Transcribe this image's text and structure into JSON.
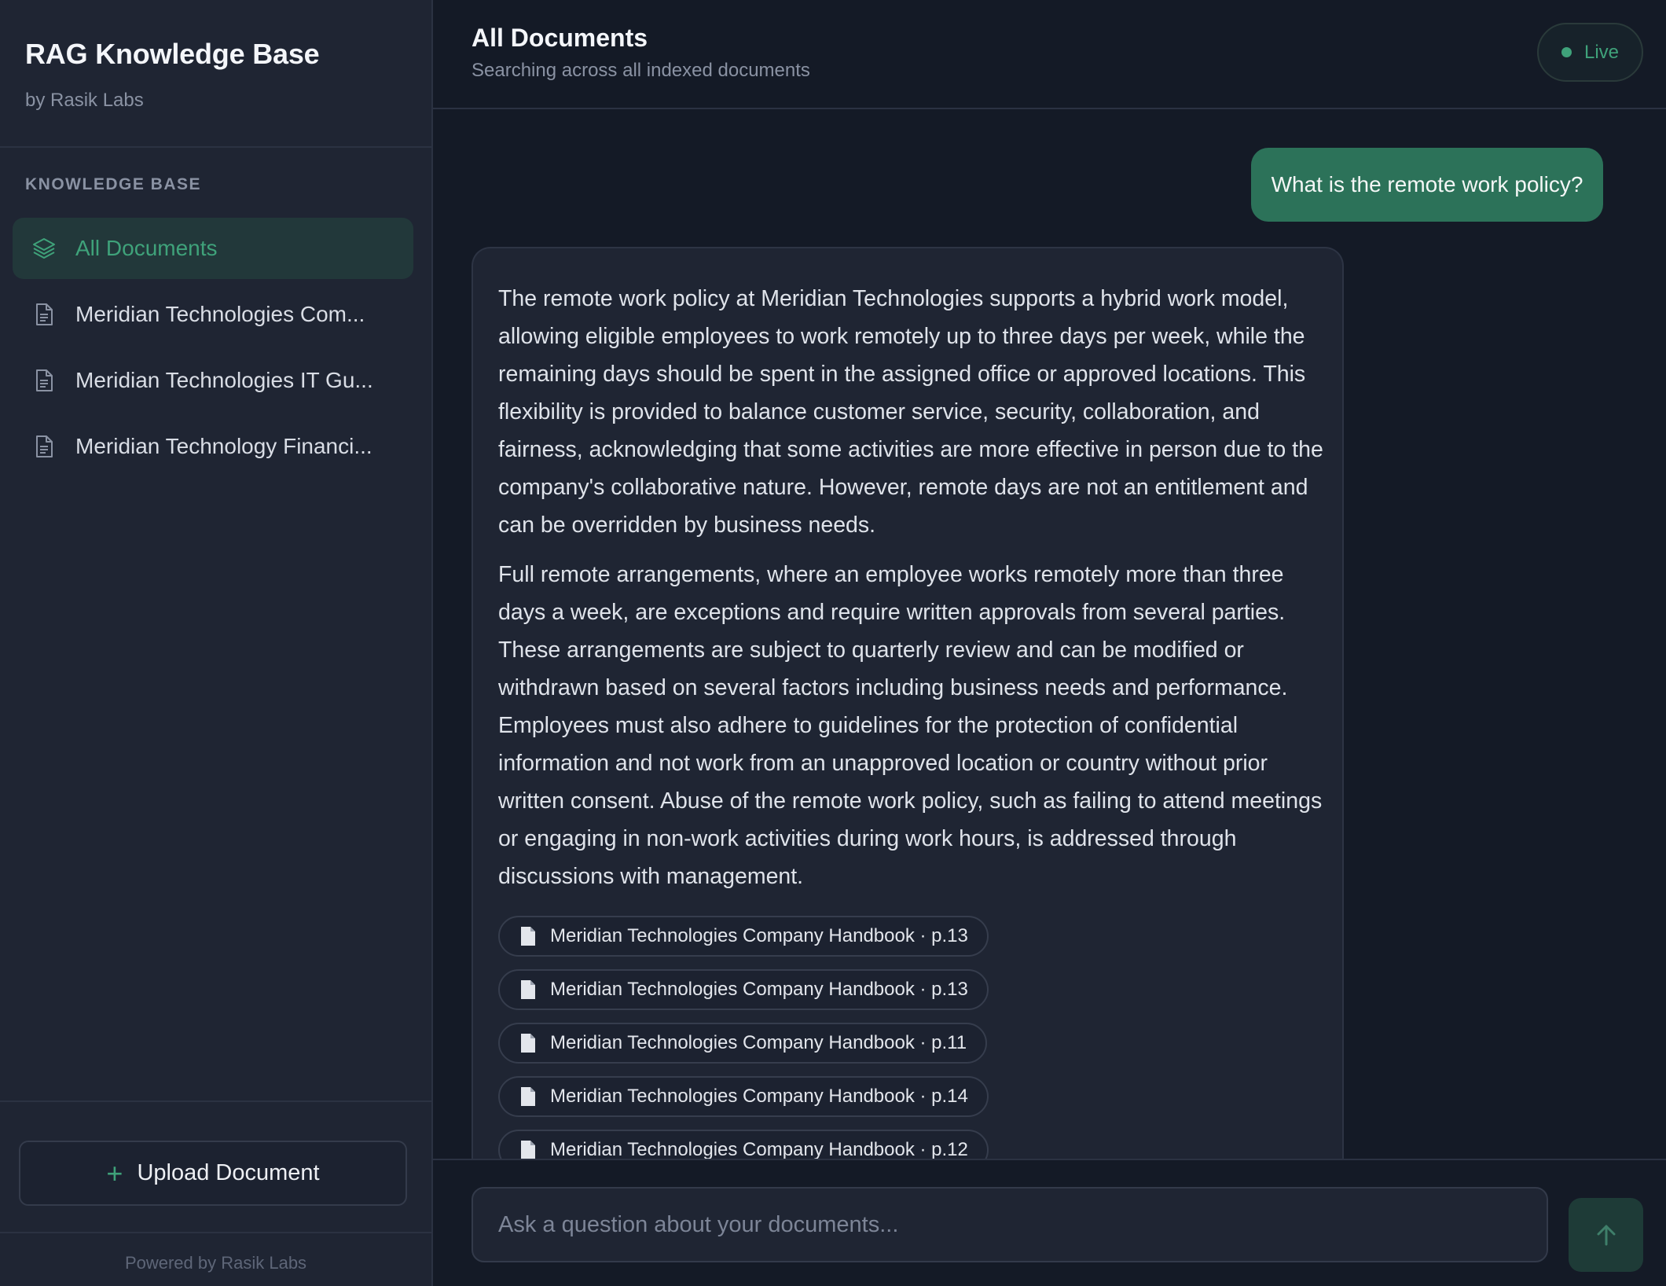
{
  "sidebar": {
    "brand_title": "RAG Knowledge Base",
    "brand_subtitle": "by Rasik Labs",
    "section_label": "KNOWLEDGE BASE",
    "items": [
      {
        "label": "All Documents",
        "icon": "layers-icon",
        "active": true
      },
      {
        "label": "Meridian Technologies Com...",
        "icon": "document-icon"
      },
      {
        "label": "Meridian Technologies IT Gu...",
        "icon": "document-icon"
      },
      {
        "label": "Meridian Technology Financi...",
        "icon": "document-icon"
      }
    ],
    "upload_label": "Upload Document",
    "footer": "Powered by Rasik Labs"
  },
  "header": {
    "title": "All Documents",
    "subtitle": "Searching across all indexed documents",
    "status": "Live"
  },
  "chat": {
    "user_message": "What is the remote work policy?",
    "answer_paragraphs": [
      "The remote work policy at Meridian Technologies supports a hybrid work model, allowing eligible employees to work remotely up to three days per week, while the remaining days should be spent in the assigned office or approved locations. This flexibility is provided to balance customer service, security, collaboration, and fairness, acknowledging that some activities are more effective in person due to the company's collaborative nature. However, remote days are not an entitlement and can be overridden by business needs.",
      "Full remote arrangements, where an employee works remotely more than three days a week, are exceptions and require written approvals from several parties. These arrangements are subject to quarterly review and can be modified or withdrawn based on several factors including business needs and performance. Employees must also adhere to guidelines for the protection of confidential information and not work from an unapproved location or country without prior written consent. Abuse of the remote work policy, such as failing to attend meetings or engaging in non-work activities during work hours, is addressed through discussions with management."
    ],
    "sources": [
      "Meridian Technologies Company Handbook · p.13",
      "Meridian Technologies Company Handbook · p.13",
      "Meridian Technologies Company Handbook · p.11",
      "Meridian Technologies Company Handbook · p.14",
      "Meridian Technologies Company Handbook · p.12"
    ]
  },
  "input": {
    "placeholder": "Ask a question about your documents...",
    "value": ""
  },
  "colors": {
    "accent": "#3fa27a",
    "user_bubble": "#2c7259",
    "background": "#141a26",
    "sidebar": "#1f2533"
  }
}
